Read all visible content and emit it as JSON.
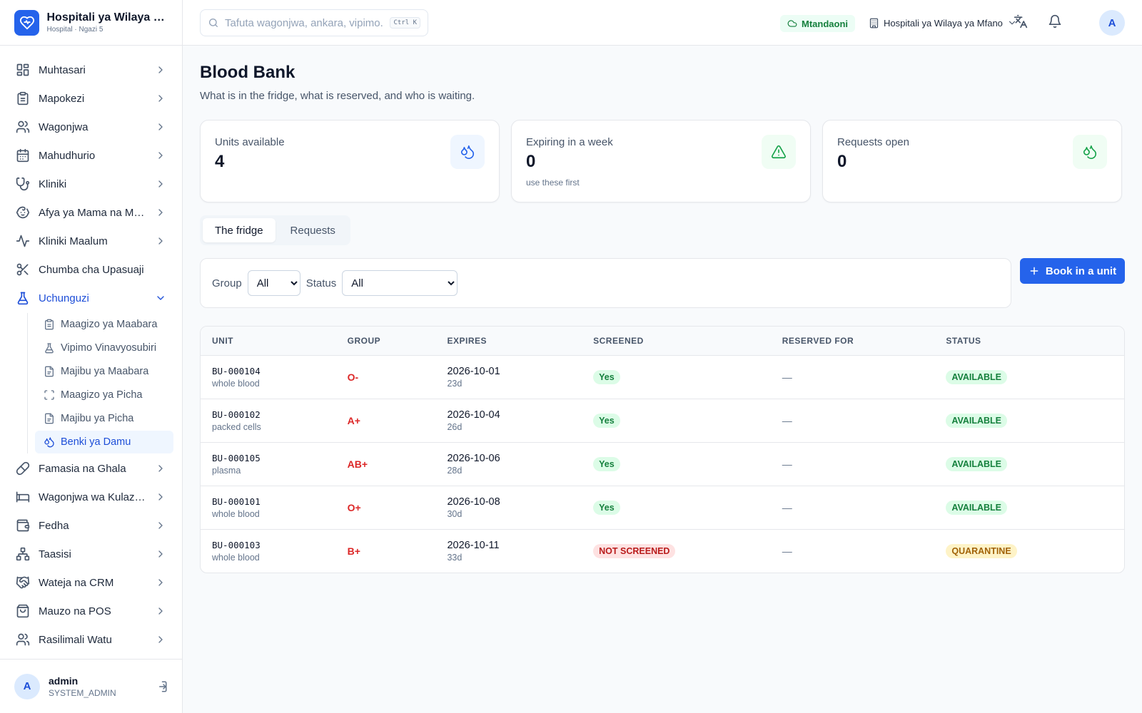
{
  "brand": {
    "name": "Hospitali ya Wilaya ya Mfano",
    "subtitle": "Hospital · Ngazi 5"
  },
  "sidebar": {
    "items_top": [
      {
        "label": "Muhtasari",
        "icon": "dashboard-icon",
        "chevron": true
      },
      {
        "label": "Mapokezi",
        "icon": "clipboard-icon",
        "chevron": true
      },
      {
        "label": "Wagonjwa",
        "icon": "users-icon",
        "chevron": true
      },
      {
        "label": "Mahudhurio",
        "icon": "calendar-icon",
        "chevron": true
      },
      {
        "label": "Kliniki",
        "icon": "stethoscope-icon",
        "chevron": true
      },
      {
        "label": "Afya ya Mama na Mtoto",
        "icon": "baby-icon",
        "chevron": true
      },
      {
        "label": "Kliniki Maalum",
        "icon": "activity-icon",
        "chevron": true
      },
      {
        "label": "Chumba cha Upasuaji",
        "icon": "scissors-icon",
        "chevron": false
      }
    ],
    "active_group": {
      "label": "Uchunguzi",
      "icon": "flask-icon"
    },
    "sub_items": [
      {
        "label": "Maagizo ya Maabara",
        "icon": "clipboard-icon"
      },
      {
        "label": "Vipimo Vinavyosubiri",
        "icon": "flask-icon"
      },
      {
        "label": "Majibu ya Maabara",
        "icon": "file-icon"
      },
      {
        "label": "Maagizo ya Picha",
        "icon": "scan-icon"
      },
      {
        "label": "Majibu ya Picha",
        "icon": "file-icon"
      },
      {
        "label": "Benki ya Damu",
        "icon": "droplets-icon",
        "active": true
      }
    ],
    "items_bottom": [
      {
        "label": "Famasia na Ghala",
        "icon": "pill-icon",
        "chevron": true
      },
      {
        "label": "Wagonjwa wa Kulazwa",
        "icon": "bed-icon",
        "chevron": true
      },
      {
        "label": "Fedha",
        "icon": "wallet-icon",
        "chevron": true
      },
      {
        "label": "Taasisi",
        "icon": "network-icon",
        "chevron": true
      },
      {
        "label": "Wateja na CRM",
        "icon": "handshake-icon",
        "chevron": true
      },
      {
        "label": "Mauzo na POS",
        "icon": "shopping-bag-icon",
        "chevron": true
      },
      {
        "label": "Rasilimali Watu",
        "icon": "users-icon",
        "chevron": true
      }
    ]
  },
  "user": {
    "initial": "A",
    "name": "admin",
    "role": "SYSTEM_ADMIN"
  },
  "topbar": {
    "search_placeholder": "Tafuta wagonjwa, ankara, vipimo...",
    "shortcut": "Ctrl K",
    "online_label": "Mtandaoni",
    "facility": "Hospitali ya Wilaya ya Mfano",
    "avatar_initial": "A"
  },
  "page": {
    "title": "Blood Bank",
    "subtitle": "What is in the fridge, what is reserved, and who is waiting."
  },
  "stats": [
    {
      "label": "Units available",
      "value": "4",
      "hint": "",
      "icon": "droplets-icon",
      "tone": "#2563eb",
      "bg": "#eff6ff"
    },
    {
      "label": "Expiring in a week",
      "value": "0",
      "hint": "use these first",
      "icon": "alert-triangle-icon",
      "tone": "#16a34a",
      "bg": "#f0fdf4"
    },
    {
      "label": "Requests open",
      "value": "0",
      "hint": "",
      "icon": "droplets-icon",
      "tone": "#16a34a",
      "bg": "#f0fdf4"
    }
  ],
  "tabs": [
    {
      "label": "The fridge",
      "active": true
    },
    {
      "label": "Requests",
      "active": false
    }
  ],
  "filters": {
    "group_label": "Group",
    "group_value": "All",
    "status_label": "Status",
    "status_value": "All"
  },
  "book_button": "Book in a unit",
  "table": {
    "headers": [
      "UNIT",
      "GROUP",
      "EXPIRES",
      "SCREENED",
      "RESERVED FOR",
      "STATUS"
    ],
    "rows": [
      {
        "unit": "BU-000104",
        "type": "whole blood",
        "group": "O-",
        "expires": "2026-10-01",
        "days": "23d",
        "screened": "Yes",
        "reserved": "—",
        "status": "AVAILABLE"
      },
      {
        "unit": "BU-000102",
        "type": "packed cells",
        "group": "A+",
        "expires": "2026-10-04",
        "days": "26d",
        "screened": "Yes",
        "reserved": "—",
        "status": "AVAILABLE"
      },
      {
        "unit": "BU-000105",
        "type": "plasma",
        "group": "AB+",
        "expires": "2026-10-06",
        "days": "28d",
        "screened": "Yes",
        "reserved": "—",
        "status": "AVAILABLE"
      },
      {
        "unit": "BU-000101",
        "type": "whole blood",
        "group": "O+",
        "expires": "2026-10-08",
        "days": "30d",
        "screened": "Yes",
        "reserved": "—",
        "status": "AVAILABLE"
      },
      {
        "unit": "BU-000103",
        "type": "whole blood",
        "group": "B+",
        "expires": "2026-10-11",
        "days": "33d",
        "screened": "NOT SCREENED",
        "reserved": "—",
        "status": "QUARANTINE"
      }
    ]
  },
  "colors": {
    "accent": "#2563eb",
    "danger": "#dc2626",
    "success": "#15803d",
    "warning": "#a16207"
  }
}
